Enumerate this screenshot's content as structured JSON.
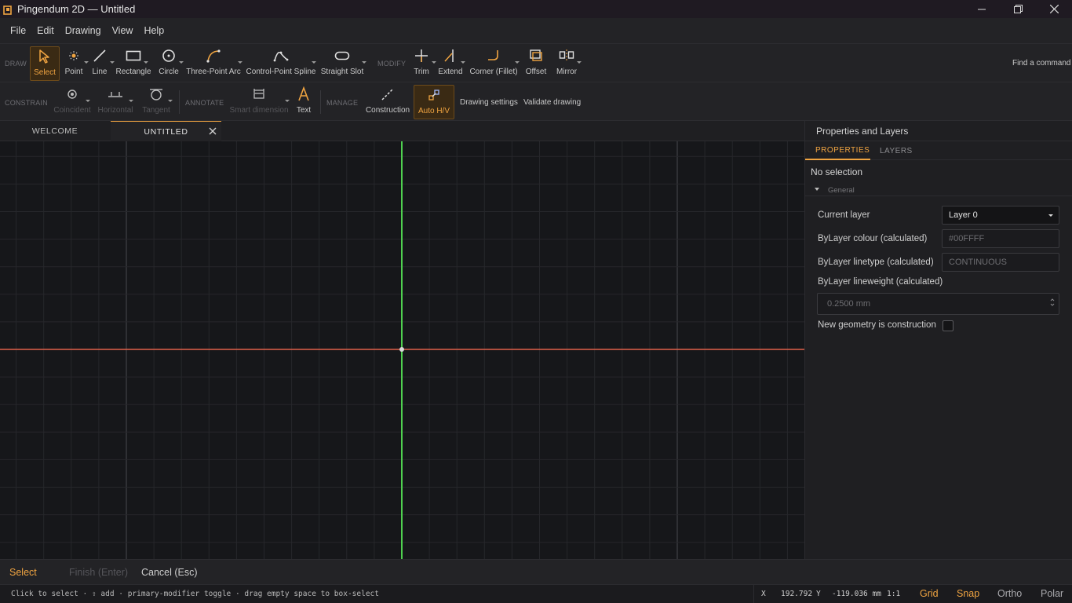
{
  "window": {
    "title": "Pingendum 2D — Untitled",
    "accent": "#f0a441"
  },
  "menu": [
    "File",
    "Edit",
    "Drawing",
    "View",
    "Help"
  ],
  "ribbon": {
    "draw_label": "DRAW",
    "modify_label": "MODIFY",
    "find_command": "Find a command",
    "draw_tools": {
      "select": "Select",
      "point": "Point",
      "line": "Line",
      "rectangle": "Rectangle",
      "circle": "Circle",
      "arc": "Three-Point Arc",
      "spline": "Control-Point Spline",
      "slot": "Straight Slot"
    },
    "modify_tools": {
      "trim": "Trim",
      "extend": "Extend",
      "corner": "Corner (Fillet)",
      "offset": "Offset",
      "mirror": "Mirror"
    },
    "constrain_label": "CONSTRAIN",
    "annotate_label": "ANNOTATE",
    "manage_label": "MANAGE",
    "constrain_tools": {
      "coincident": "Coincident",
      "horizontal": "Horizontal",
      "tangent": "Tangent"
    },
    "annotate_tools": {
      "smart_dimension": "Smart dimension",
      "text": "Text"
    },
    "manage_tools": {
      "construction": "Construction",
      "auto_hv": "Auto H/V",
      "drawing_settings": "Drawing settings",
      "validate": "Validate drawing"
    }
  },
  "tabs": {
    "welcome": "WELCOME",
    "untitled": "UNTITLED"
  },
  "canvas": {
    "x_axis_color": "#e0604a",
    "y_axis_color": "#4fd04f"
  },
  "panel": {
    "title": "Properties and Layers",
    "tab_properties": "PROPERTIES",
    "tab_layers": "LAYERS",
    "no_selection": "No selection",
    "section_general": "General",
    "current_layer_label": "Current layer",
    "current_layer_value": "Layer 0",
    "colour_label": "ByLayer colour (calculated)",
    "colour_value": "#00FFFF",
    "linetype_label": "ByLayer linetype (calculated)",
    "linetype_value": "CONTINUOUS",
    "lineweight_label": "ByLayer lineweight (calculated)",
    "lineweight_value": "0.2500 mm",
    "construction_label": "New geometry is construction"
  },
  "commandbar": {
    "select": "Select",
    "finish": "Finish (Enter)",
    "cancel": "Cancel (Esc)"
  },
  "status": {
    "hint": "Click to select · ⇧ add · primary-modifier toggle · drag empty space to box-select",
    "x_label": "X",
    "x_value": "192.792",
    "y_label": "Y",
    "y_value": "-119.036 mm",
    "scale": "1:1",
    "grid": "Grid",
    "snap": "Snap",
    "ortho": "Ortho",
    "polar": "Polar"
  }
}
